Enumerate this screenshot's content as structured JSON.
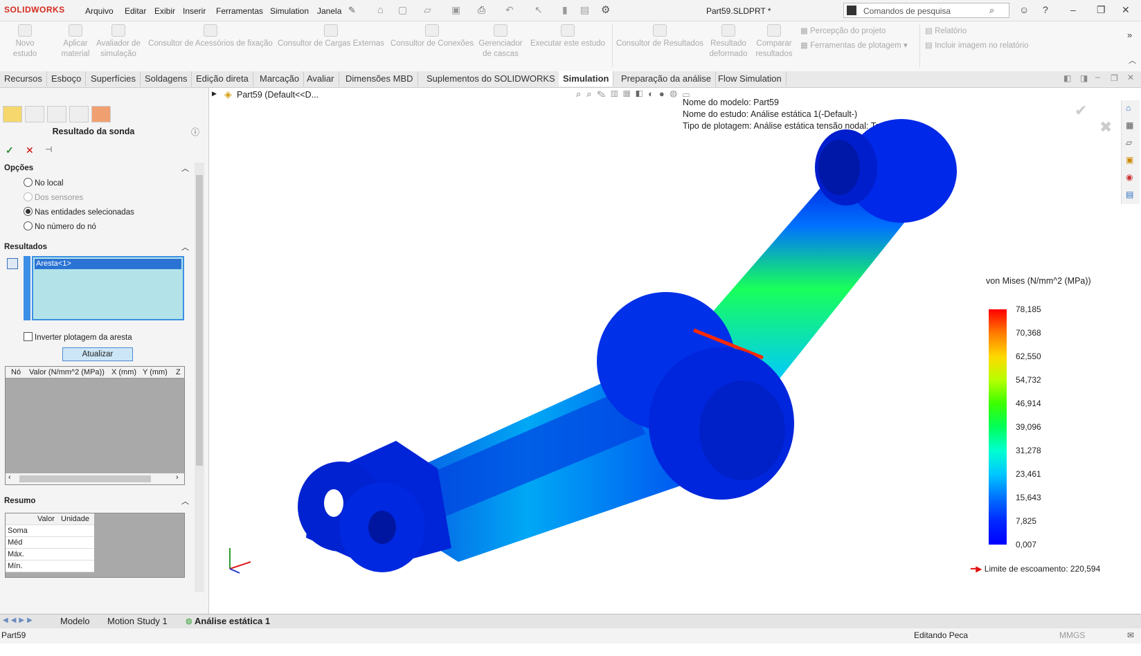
{
  "app": {
    "brand": "SOLIDWORKS",
    "doc_title": "Part59.SLDPRT *"
  },
  "menu": [
    "Arquivo",
    "Editar",
    "Exibir",
    "Inserir",
    "Ferramentas",
    "Simulation",
    "Janela"
  ],
  "search": {
    "placeholder": "Comandos de pesquisa"
  },
  "command_manager": {
    "buttons": [
      {
        "label": "Novo estudo"
      },
      {
        "label": "Aplicar material"
      },
      {
        "label": "Avaliador de simulação"
      },
      {
        "label": "Consultor de Acessórios de fixação"
      },
      {
        "label": "Consultor de Cargas Externas"
      },
      {
        "label": "Consultor de Conexões"
      },
      {
        "label": "Gerenciador de cascas"
      },
      {
        "label": "Executar este estudo"
      },
      {
        "label": "Consultor de Resultados"
      },
      {
        "label": "Resultado deformado"
      },
      {
        "label": "Comparar resultados"
      }
    ],
    "small": [
      "Percepção do projeto",
      "Ferramentas de plotagem",
      "Relatório",
      "Incluir imagem no relatório"
    ]
  },
  "tabs": [
    "Recursos",
    "Esboço",
    "Superfícies",
    "Soldagens",
    "Edição direta",
    "Marcação",
    "Avaliar",
    "Dimensões MBD",
    "Suplementos do SOLIDWORKS",
    "Simulation",
    "Preparação da análise",
    "Flow Simulation"
  ],
  "active_tab": "Simulation",
  "property_manager": {
    "title": "Resultado da sonda",
    "options_title": "Opções",
    "options": [
      {
        "label": "No local",
        "selected": false,
        "disabled": false
      },
      {
        "label": "Dos sensores",
        "selected": false,
        "disabled": true
      },
      {
        "label": "Nas entidades selecionadas",
        "selected": true,
        "disabled": false
      },
      {
        "label": "No número do nó",
        "selected": false,
        "disabled": false
      }
    ],
    "results_title": "Resultados",
    "selection": "Aresta<1>",
    "invert_label": "Inverter plotagem da aresta",
    "update_label": "Atualizar",
    "grid_headers": [
      "Nó",
      "Valor (N/mm^2 (MPa))",
      "X (mm)",
      "Y (mm)",
      "Z"
    ],
    "summary_title": "Resumo",
    "summary_headers": [
      "Valor",
      "Unidade"
    ],
    "summary_rows": [
      "Soma",
      "Méd",
      "Máx.",
      "Mín."
    ]
  },
  "tree": {
    "root": "Part59  (Default<<D..."
  },
  "plot_info": {
    "model": "Nome do modelo: Part59",
    "study": "Nome do estudo: Análise estática 1(-Default-)",
    "plot": "Tipo de plotagem: Análise estática tensão nodal: Tensão1"
  },
  "legend": {
    "title": "von Mises (N/mm^2 (MPa))",
    "values": [
      "78,185",
      "70,368",
      "62,550",
      "54,732",
      "46,914",
      "39,096",
      "31,278",
      "23,461",
      "15,643",
      "7,825",
      "0,007"
    ],
    "yield": "Limite de escoamento: 220,594"
  },
  "bottom_tabs": [
    "Modelo",
    "Motion Study 1",
    "Análise estática 1"
  ],
  "status": {
    "left": "Part59",
    "mode": "Editando Peca",
    "units": "MMGS"
  }
}
